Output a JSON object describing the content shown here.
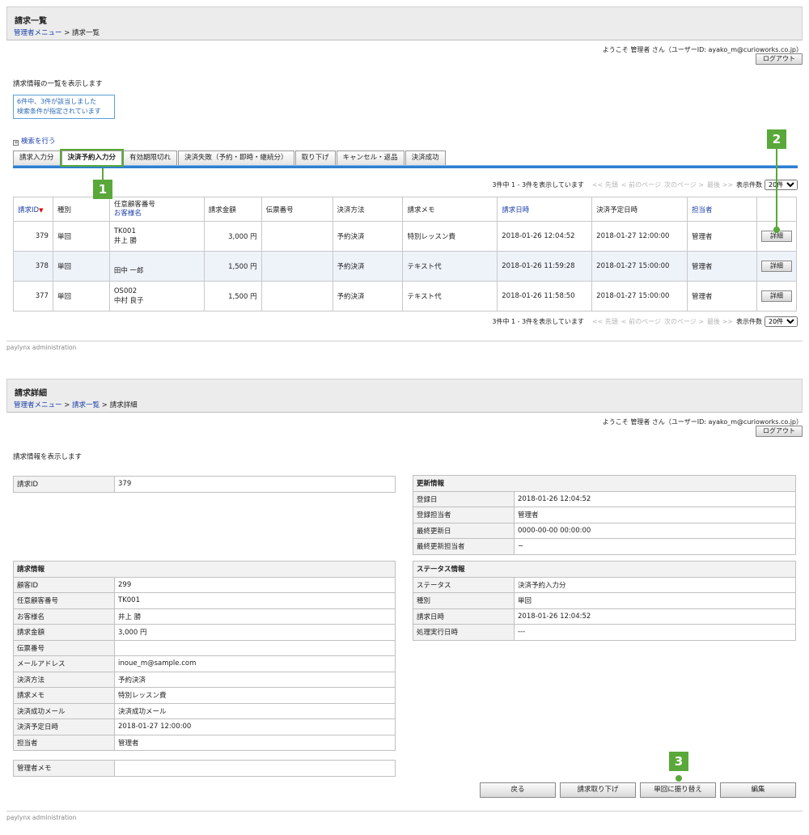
{
  "list_page": {
    "title": "請求一覧",
    "breadcrumb": {
      "menu": "管理者メニュー",
      "sep": " > ",
      "current": "請求一覧"
    },
    "welcome": "ようこそ 管理者 さん（ユーザーID: ayako_m@curioworks.co.jp）",
    "logout": "ログアウト",
    "intro": "請求情報の一覧を表示します",
    "notice_line1": "6件中、3件が該当しました",
    "notice_line2": "検索条件が指定されています",
    "search_toggle_box": "+",
    "search_toggle": "検索を行う",
    "tabs": [
      "請求入力分",
      "決済予約入力分",
      "有効期限切れ",
      "決済失敗（予約・即時・継続分）",
      "取り下げ",
      "キャンセル・返品",
      "決済成功"
    ],
    "pager": {
      "summary": "3件中 1 - 3件を表示しています",
      "first": "<< 先頭",
      "prev": "< 前のページ",
      "next": "次のページ >",
      "last": "最後 >>",
      "per_page_label": "表示件数",
      "per_page_value": "20件"
    },
    "columns": {
      "id": "請求ID",
      "sort_mark": "▼",
      "type": "種別",
      "cust_no": "任意顧客番号",
      "cust_name": "お客様名",
      "amount": "請求金額",
      "slip": "伝票番号",
      "method": "決済方法",
      "memo": "請求メモ",
      "date": "請求日時",
      "scheduled": "決済予定日時",
      "staff": "担当者"
    },
    "rows": [
      {
        "id": "379",
        "type": "単回",
        "cust_no": "TK001",
        "cust_name": "井上 勝",
        "amount": "3,000 円",
        "slip": "",
        "method": "予約決済",
        "memo": "特別レッスン費",
        "date": "2018-01-26 12:04:52",
        "scheduled": "2018-01-27 12:00:00",
        "staff": "管理者",
        "detail": "詳細"
      },
      {
        "id": "378",
        "type": "単回",
        "cust_no": "",
        "cust_name": "田中 一郎",
        "amount": "1,500 円",
        "slip": "",
        "method": "予約決済",
        "memo": "テキスト代",
        "date": "2018-01-26 11:59:28",
        "scheduled": "2018-01-27 15:00:00",
        "staff": "管理者",
        "detail": "詳細"
      },
      {
        "id": "377",
        "type": "単回",
        "cust_no": "OS002",
        "cust_name": "中村 良子",
        "amount": "1,500 円",
        "slip": "",
        "method": "予約決済",
        "memo": "テキスト代",
        "date": "2018-01-26 11:58:50",
        "scheduled": "2018-01-27 15:00:00",
        "staff": "管理者",
        "detail": "詳細"
      }
    ],
    "footer": "paylynx administration"
  },
  "detail_page": {
    "title": "請求詳細",
    "breadcrumb": {
      "menu": "管理者メニュー",
      "sep1": " > ",
      "list": "請求一覧",
      "sep2": " > ",
      "current": "請求詳細"
    },
    "welcome": "ようこそ 管理者 さん（ユーザーID: ayako_m@curioworks.co.jp）",
    "logout": "ログアウト",
    "intro": "請求情報を表示します",
    "billing_id": {
      "label": "請求ID",
      "value": "379"
    },
    "billing_info": {
      "heading": "請求情報",
      "rows": [
        {
          "label": "顧客ID",
          "value": "299"
        },
        {
          "label": "任意顧客番号",
          "value": "TK001"
        },
        {
          "label": "お客様名",
          "value": "井上 勝"
        },
        {
          "label": "請求金額",
          "value": "3,000 円"
        },
        {
          "label": "伝票番号",
          "value": ""
        },
        {
          "label": "メールアドレス",
          "value": "inoue_m@sample.com"
        },
        {
          "label": "決済方法",
          "value": "予約決済"
        },
        {
          "label": "請求メモ",
          "value": "特別レッスン費"
        },
        {
          "label": "決済成功メール",
          "value": "決済成功メール"
        },
        {
          "label": "決済予定日時",
          "value": "2018-01-27 12:00:00"
        },
        {
          "label": "担当者",
          "value": "管理者"
        }
      ]
    },
    "admin_memo": {
      "label": "管理者メモ",
      "value": ""
    },
    "update_info": {
      "heading": "更新情報",
      "rows": [
        {
          "label": "登録日",
          "value": "2018-01-26 12:04:52"
        },
        {
          "label": "登録担当者",
          "value": "管理者"
        },
        {
          "label": "最終更新日",
          "value": "0000-00-00 00:00:00"
        },
        {
          "label": "最終更新担当者",
          "value": "−"
        }
      ]
    },
    "status_info": {
      "heading": "ステータス情報",
      "rows": [
        {
          "label": "ステータス",
          "value": "決済予約入力分"
        },
        {
          "label": "種別",
          "value": "単回"
        },
        {
          "label": "請求日時",
          "value": "2018-01-26 12:04:52"
        },
        {
          "label": "処理実行日時",
          "value": "---"
        }
      ]
    },
    "buttons": {
      "back": "戻る",
      "withdraw": "請求取り下げ",
      "switch_single": "単回に振り替え",
      "edit": "編集"
    },
    "footer": "paylynx administration"
  },
  "markers": {
    "m1": "1",
    "m2": "2",
    "m3": "3"
  },
  "colors": {
    "accent_green": "#5aa83a",
    "tab_bar_blue": "#2f7fd0",
    "link_blue": "#1a3fa8",
    "sort_red": "#dd0000"
  }
}
